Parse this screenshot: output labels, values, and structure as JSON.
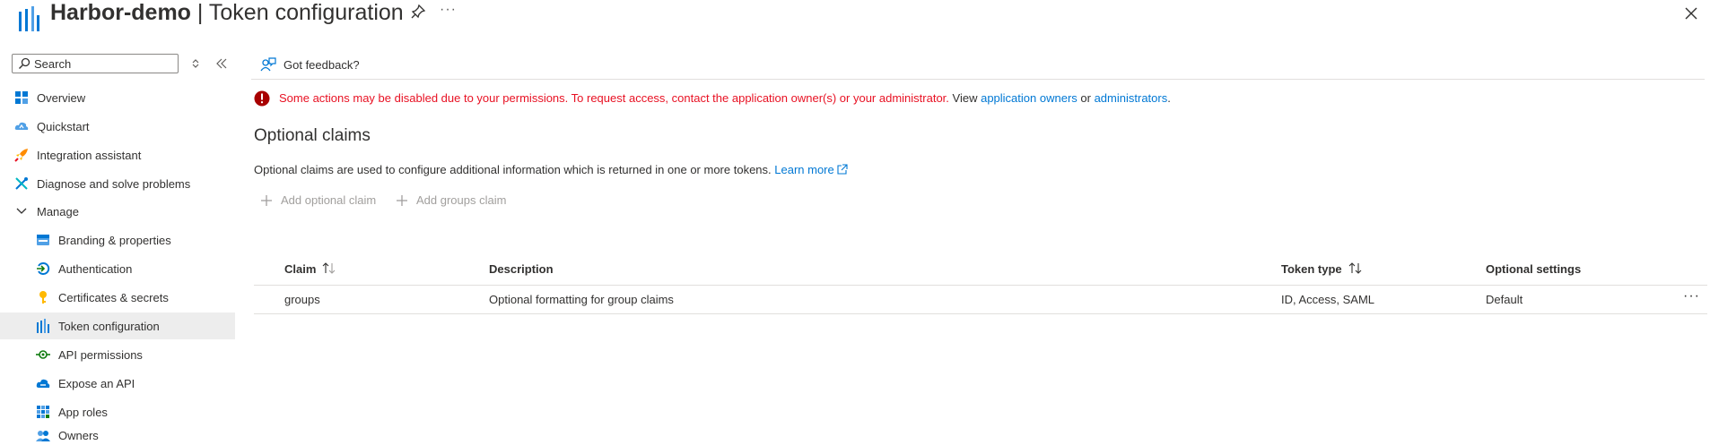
{
  "header": {
    "app_name": "Harbor-demo",
    "separator": " | ",
    "page_name": "Token configuration",
    "more_label": "···"
  },
  "sidebar": {
    "search_placeholder": "Search",
    "items": [
      {
        "label": "Overview",
        "icon": "overview-grid-icon"
      },
      {
        "label": "Quickstart",
        "icon": "quickstart-cloud-icon"
      },
      {
        "label": "Integration assistant",
        "icon": "rocket-icon"
      },
      {
        "label": "Diagnose and solve problems",
        "icon": "wrench-cross-icon"
      },
      {
        "label": "Manage",
        "icon": "chevron-down-icon"
      },
      {
        "label": "Branding & properties",
        "icon": "branding-icon"
      },
      {
        "label": "Authentication",
        "icon": "authentication-icon"
      },
      {
        "label": "Certificates & secrets",
        "icon": "key-icon"
      },
      {
        "label": "Token configuration",
        "icon": "token-bars-icon",
        "selected": true
      },
      {
        "label": "API permissions",
        "icon": "api-permissions-icon"
      },
      {
        "label": "Expose an API",
        "icon": "cloud-api-icon"
      },
      {
        "label": "App roles",
        "icon": "app-roles-grid-icon"
      },
      {
        "label": "Owners",
        "icon": "owners-icon"
      }
    ]
  },
  "toolbar": {
    "feedback_label": "Got feedback?"
  },
  "warning": {
    "text": "Some actions may be disabled due to your permissions. To request access, contact the application owner(s) or your administrator.",
    "view": " View ",
    "link1": "application owners",
    "or": " or ",
    "link2": "administrators",
    "period": "."
  },
  "section": {
    "title": "Optional claims",
    "description": "Optional claims are used to configure additional information which is returned in one or more tokens. ",
    "learn_more": "Learn more"
  },
  "commands": {
    "add_optional_claim": "Add optional claim",
    "add_groups_claim": "Add groups claim"
  },
  "table": {
    "columns": [
      "Claim",
      "Description",
      "Token type",
      "Optional settings"
    ],
    "rows": [
      {
        "claim": "groups",
        "description": "Optional formatting for group claims",
        "token_type": "ID, Access, SAML",
        "optional_settings": "Default"
      }
    ],
    "row_more_label": "···"
  },
  "colors": {
    "accent": "#0078d4",
    "error": "#e81123",
    "selected_bg": "#ededed"
  }
}
